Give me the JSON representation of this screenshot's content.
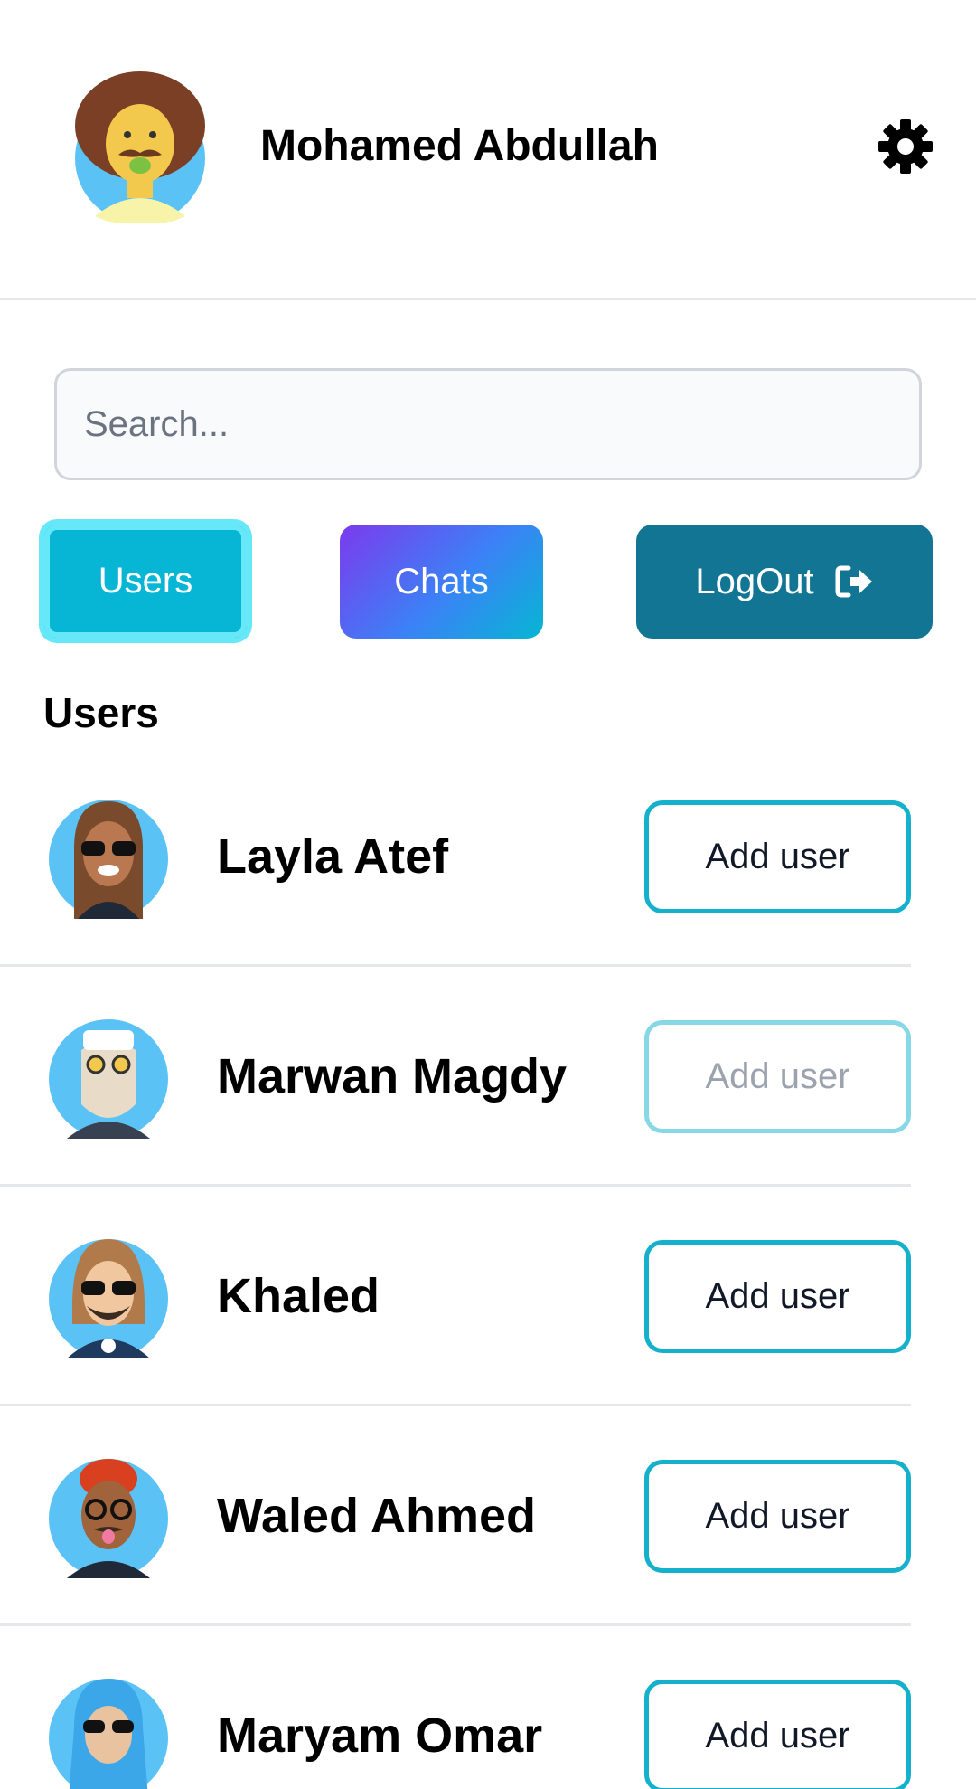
{
  "header": {
    "user_name": "Mohamed Abdullah",
    "avatar_icon": "user-avatar-icon",
    "settings_icon": "gear-icon"
  },
  "search": {
    "placeholder": "Search...",
    "value": ""
  },
  "nav": {
    "users_label": "Users",
    "chats_label": "Chats",
    "logout_label": "LogOut",
    "logout_icon": "logout-icon",
    "active": "Users"
  },
  "section": {
    "title": "Users"
  },
  "users": [
    {
      "name": "Layla Atef",
      "action_label": "Add user",
      "disabled": false
    },
    {
      "name": "Marwan Magdy",
      "action_label": "Add user",
      "disabled": true
    },
    {
      "name": "Khaled",
      "action_label": "Add user",
      "disabled": false
    },
    {
      "name": "Waled Ahmed",
      "action_label": "Add user",
      "disabled": false
    },
    {
      "name": "Maryam Omar",
      "action_label": "Add user",
      "disabled": false
    }
  ],
  "colors": {
    "accent": "#06b6d4",
    "logout_bg": "#117593",
    "chats_gradient_start": "#7c3aed",
    "chats_gradient_end": "#06b6d4",
    "add_border": "#14b0cc"
  }
}
